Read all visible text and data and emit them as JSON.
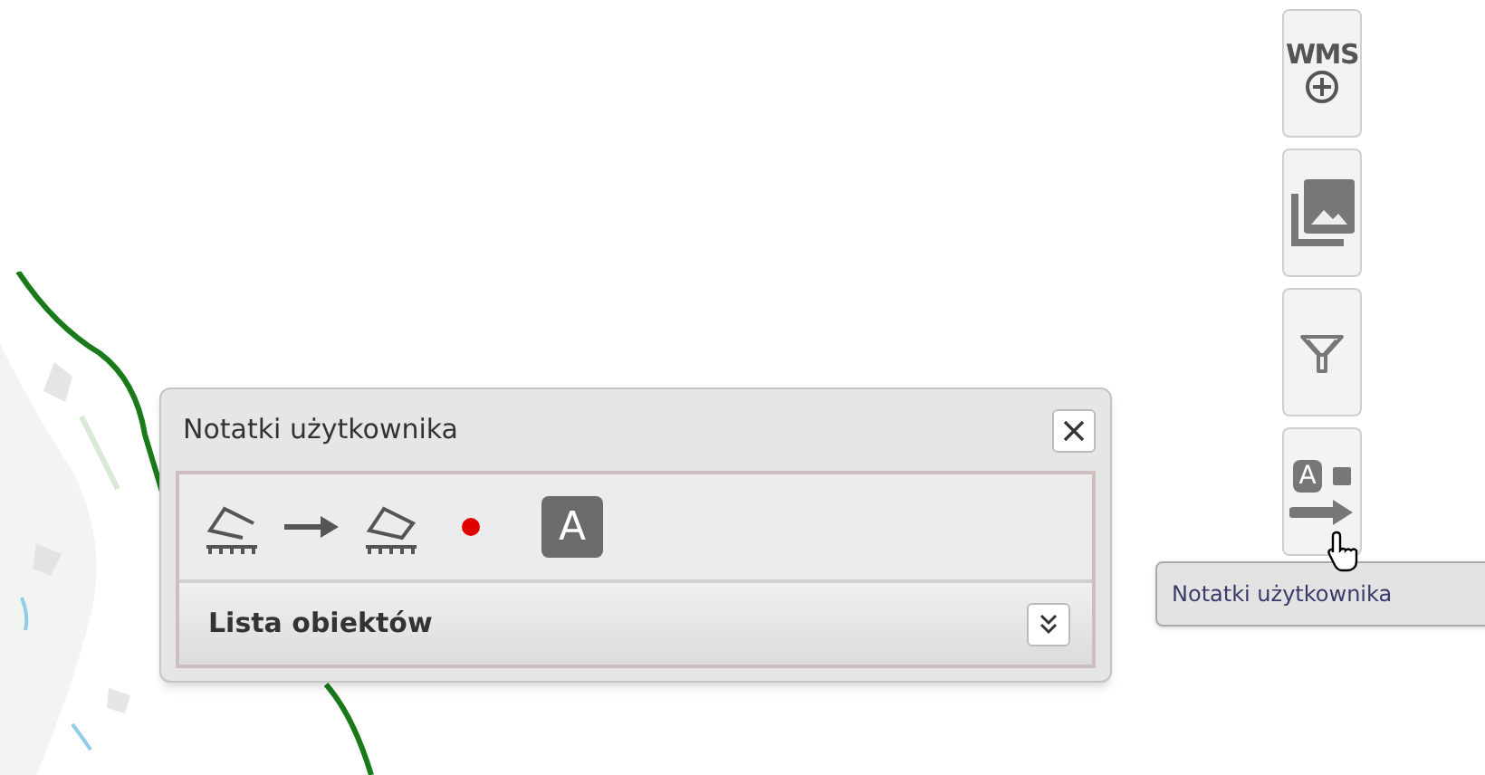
{
  "toolbar": [
    {
      "kind": "wms",
      "label": "WMS"
    },
    {
      "kind": "layers"
    },
    {
      "kind": "filter"
    },
    {
      "kind": "notes",
      "label": "A"
    }
  ],
  "tooltip": {
    "text": "Notatki użytkownika"
  },
  "panel": {
    "title": "Notatki użytkownika",
    "tools": [
      {
        "kind": "measure-line"
      },
      {
        "kind": "arrow"
      },
      {
        "kind": "measure-polygon"
      },
      {
        "kind": "point"
      },
      {
        "kind": "text",
        "label": "A"
      }
    ],
    "list_section": {
      "title": "Lista obiektów",
      "expanded": false
    }
  }
}
